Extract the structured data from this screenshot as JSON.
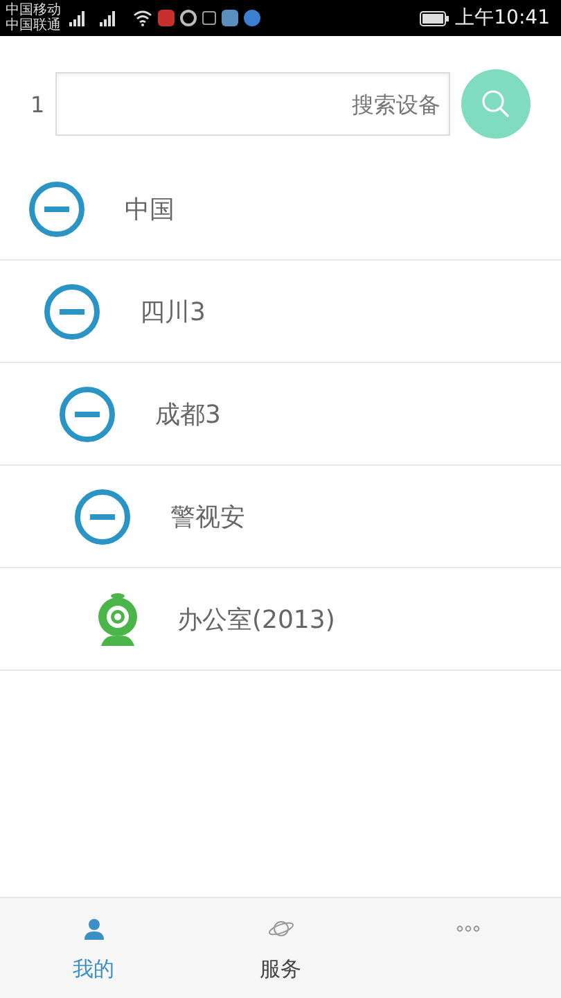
{
  "status_bar": {
    "carrier_1": "中国移动",
    "carrier_2": "中国联通",
    "time": "上午10:41"
  },
  "search": {
    "count": "1",
    "placeholder": "搜索设备"
  },
  "tree": [
    {
      "kind": "group",
      "label": "中国",
      "expanded": true,
      "children": [
        {
          "kind": "group",
          "label": "四川3",
          "expanded": true,
          "children": [
            {
              "kind": "group",
              "label": "成都3",
              "expanded": true,
              "children": [
                {
                  "kind": "group",
                  "label": "警视安",
                  "expanded": true,
                  "children": [
                    {
                      "kind": "camera",
                      "label": "办公室(2013)"
                    }
                  ]
                }
              ]
            }
          ]
        }
      ]
    }
  ],
  "tabs": [
    {
      "kind": "person",
      "label": "我的",
      "selected": true
    },
    {
      "kind": "planet",
      "label": "服务",
      "selected": false
    },
    {
      "kind": "more",
      "selected": false
    }
  ]
}
